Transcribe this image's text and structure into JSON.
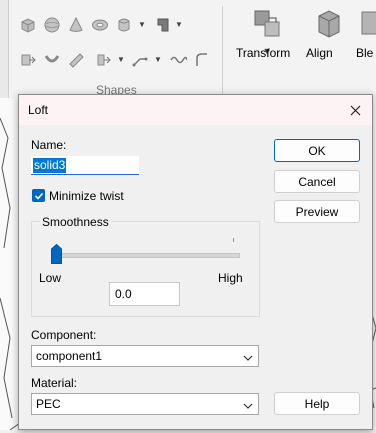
{
  "ribbon": {
    "group_label": "Shapes",
    "transform_label": "Transform",
    "align_label": "Align",
    "blend_label": "Ble"
  },
  "dialog": {
    "title": "Loft",
    "name_label": "Name:",
    "name_value": "solid3",
    "minimize_twist_label": "Minimize twist",
    "minimize_twist_checked": true,
    "smoothness_label": "Smoothness",
    "low_label": "Low",
    "high_label": "High",
    "smoothness_value": "0.0",
    "component_label": "Component:",
    "component_value": "component1",
    "material_label": "Material:",
    "material_value": "PEC",
    "buttons": {
      "ok": "OK",
      "cancel": "Cancel",
      "preview": "Preview",
      "help": "Help"
    }
  },
  "colors": {
    "accent": "#0067c0",
    "selection": "#0078d7",
    "titlebar": "#fdf2f4"
  }
}
